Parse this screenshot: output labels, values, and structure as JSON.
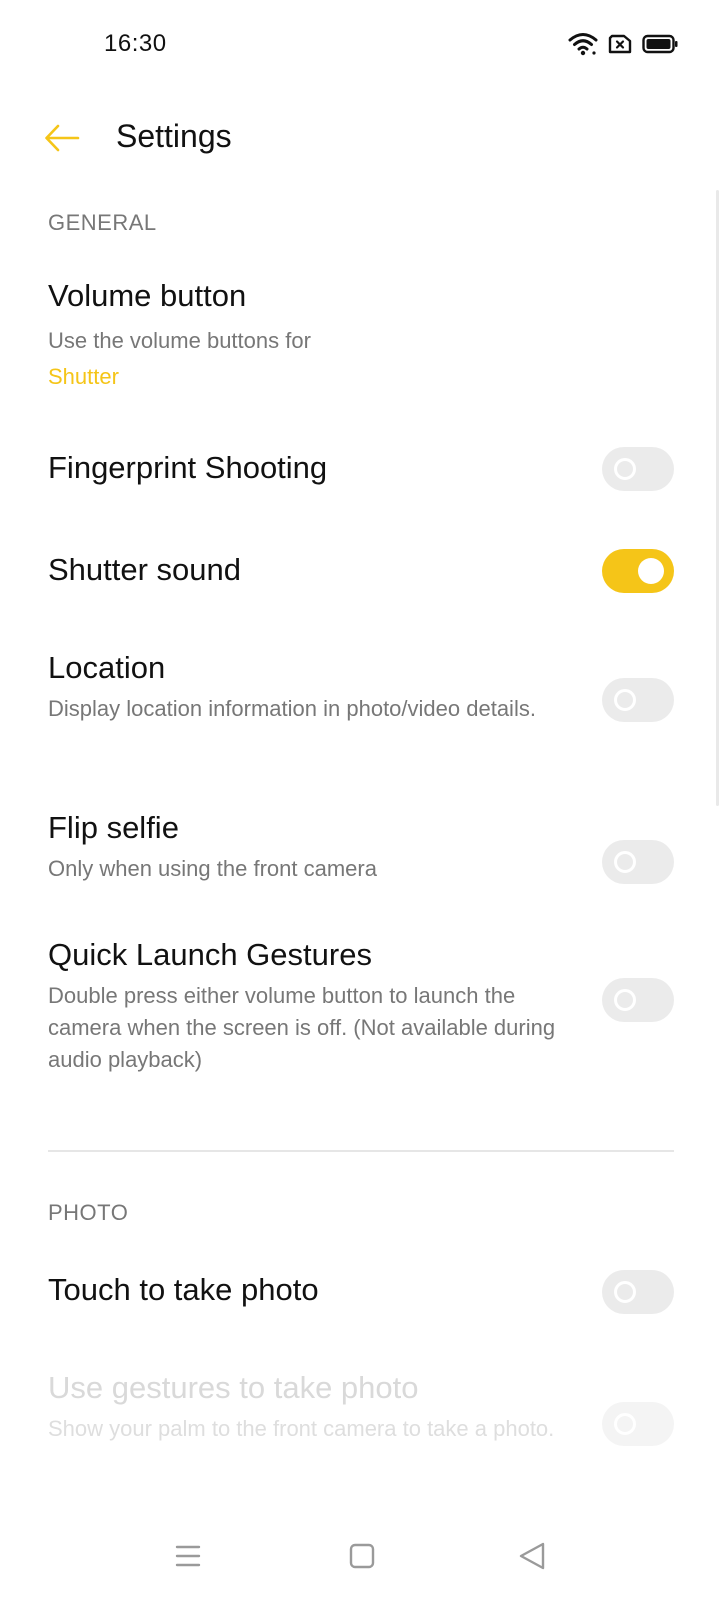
{
  "status_bar": {
    "time": "16:30",
    "icons": [
      "wifi-icon",
      "sim-blocked-icon",
      "battery-icon"
    ]
  },
  "header": {
    "back_icon": "arrow-left-icon",
    "title": "Settings"
  },
  "colors": {
    "accent": "#f5c518",
    "toggle_off": "#ebebeb",
    "text_primary": "#111111",
    "text_secondary": "#777777"
  },
  "general": {
    "header": "GENERAL",
    "volume_button": {
      "title": "Volume button",
      "desc": "Use the volume buttons for",
      "value": "Shutter"
    },
    "fingerprint_shooting": {
      "title": "Fingerprint Shooting",
      "enabled": false
    },
    "shutter_sound": {
      "title": "Shutter sound",
      "enabled": true
    },
    "location": {
      "title": "Location",
      "desc": "Display location information in photo/video details.",
      "enabled": false
    },
    "flip_selfie": {
      "title": "Flip selfie",
      "desc": "Only when using the front camera",
      "enabled": false
    },
    "quick_launch": {
      "title": "Quick Launch Gestures",
      "desc": "Double press either volume button to launch the camera when the screen is off. (Not available during audio playback)",
      "enabled": false
    }
  },
  "photo": {
    "header": "PHOTO",
    "touch_to_take": {
      "title": "Touch to take photo",
      "enabled": false
    },
    "gestures": {
      "title": "Use gestures to take photo",
      "desc": "Show your palm to the front camera to take a photo.",
      "enabled": false,
      "disabled": true
    }
  },
  "nav_bar": {
    "icons": [
      "menu-icon",
      "home-icon",
      "back-icon"
    ]
  }
}
